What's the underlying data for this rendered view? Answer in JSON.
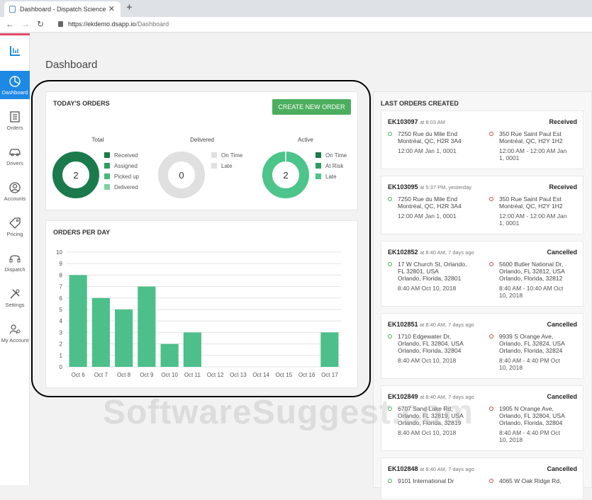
{
  "browser": {
    "tab_title": "Dashboard - Dispatch Science",
    "tab_close": "✕",
    "new_tab": "+",
    "url_host": "https://ekdemo.dsapp.io",
    "url_path": "/Dashboard"
  },
  "sidebar": {
    "items": [
      {
        "label": "Dashboard",
        "icon": "dashboard-icon"
      },
      {
        "label": "Orders",
        "icon": "orders-icon"
      },
      {
        "label": "Drivers",
        "icon": "car-icon"
      },
      {
        "label": "Accounts",
        "icon": "user-icon"
      },
      {
        "label": "Pricing",
        "icon": "tag-icon"
      },
      {
        "label": "Dispatch",
        "icon": "headset-icon"
      },
      {
        "label": "Settings",
        "icon": "tools-icon"
      },
      {
        "label": "My Account",
        "icon": "user-gear-icon"
      }
    ]
  },
  "page": {
    "title": "Dashboard"
  },
  "todays_orders": {
    "title": "TODAY'S ORDERS",
    "create_button": "CREATE NEW ORDER",
    "donuts": [
      {
        "title": "Total",
        "value": "2",
        "legend": [
          "Received",
          "Assigned",
          "Picked up",
          "Delivered"
        ],
        "colors": [
          "#1b7a4b",
          "#2e9d63",
          "#46b878",
          "#7fcf9f"
        ]
      },
      {
        "title": "Delivered",
        "value": "0",
        "legend": [
          "On Time",
          "Late"
        ],
        "colors": [
          "#e0e0e0",
          "#e0e0e0"
        ]
      },
      {
        "title": "Active",
        "value": "2",
        "legend": [
          "On Time",
          "At Risk",
          "Late"
        ],
        "colors": [
          "#1b7a4b",
          "#2e9d63",
          "#4cc48a"
        ]
      }
    ]
  },
  "orders_per_day": {
    "title": "ORDERS PER DAY"
  },
  "chart_data": {
    "type": "bar",
    "title": "ORDERS PER DAY",
    "categories": [
      "Oct 6",
      "Oct 7",
      "Oct 8",
      "Oct 9",
      "Oct 10",
      "Oct 11",
      "Oct 12",
      "Oct 13",
      "Oct 14",
      "Oct 15",
      "Oct 16",
      "Oct 17"
    ],
    "values": [
      8,
      6,
      5,
      7,
      2,
      3,
      0,
      0,
      0,
      0,
      0,
      3
    ],
    "ylim": [
      0,
      10
    ],
    "yticks": [
      "0",
      "1",
      "2",
      "3",
      "4",
      "5",
      "6",
      "7",
      "8",
      "9",
      "10"
    ],
    "color": "#4cbf8a",
    "grid": true
  },
  "last_orders": {
    "title": "LAST ORDERS CREATED",
    "orders": [
      {
        "id": "EK103097",
        "time": "at 8:03 AM",
        "status": "Received",
        "pickup": [
          "7250 Rue du Mile End",
          "Montréal, QC, H2R 3A4"
        ],
        "pickup_time": "12:00 AM Jan 1, 0001",
        "dropoff": [
          "350 Rue Saint Paul Est",
          "Montréal, QC, H2Y 1H2"
        ],
        "dropoff_time": [
          "12:00 AM - 12:00 AM Jan",
          "1, 0001"
        ]
      },
      {
        "id": "EK103095",
        "time": "at 5:37 PM, yesterday",
        "status": "Received",
        "pickup": [
          "7250 Rue du Mile End",
          "Montréal, QC, H2R 3A4"
        ],
        "pickup_time": "12:00 AM Jan 1, 0001",
        "dropoff": [
          "350 Rue Saint Paul Est",
          "Montréal, QC, H2Y 1H2"
        ],
        "dropoff_time": [
          "12:00 AM - 12:00 AM Jan",
          "1, 0001"
        ]
      },
      {
        "id": "EK102852",
        "time": "at 8:40 AM, 7 days ago",
        "status": "Cancelled",
        "pickup": [
          "17 W Church St, Orlando,",
          "FL 32801, USA",
          "Orlando, Florida, 32801"
        ],
        "pickup_time": "8:40 AM Oct 10, 2018",
        "dropoff": [
          "5600 Butler National Dr,",
          "Orlando, FL 32812, USA",
          "Orlando, Florida, 32812"
        ],
        "dropoff_time": [
          "8:40 AM - 10:40 AM Oct",
          "10, 2018"
        ]
      },
      {
        "id": "EK102851",
        "time": "at 8:40 AM, 7 days ago",
        "status": "Cancelled",
        "pickup": [
          "1710 Edgewater Dr,",
          "Orlando, FL 32804, USA",
          "Orlando, Florida, 32804"
        ],
        "pickup_time": "8:40 AM Oct 10, 2018",
        "dropoff": [
          "9939 S Orange Ave,",
          "Orlando, FL 32824, USA",
          "Orlando, Florida, 32824"
        ],
        "dropoff_time": [
          "8:40 AM - 4:40 PM Oct",
          "10, 2018"
        ]
      },
      {
        "id": "EK102849",
        "time": "at 8:40 AM, 7 days ago",
        "status": "Cancelled",
        "pickup": [
          "6707 Sand Lake Rd,",
          "Orlando, FL 32819, USA",
          "Orlando, Florida, 32819"
        ],
        "pickup_time": "8:40 AM Oct 10, 2018",
        "dropoff": [
          "1905 N Orange Ave,",
          "Orlando, FL 32804, USA",
          "Orlando, Florida, 32804"
        ],
        "dropoff_time": [
          "8:40 AM - 4:40 PM Oct",
          "10, 2018"
        ]
      },
      {
        "id": "EK102848",
        "time": "at 8:40 AM, 7 days ago",
        "status": "Cancelled",
        "pickup": [
          "9101 International Dr"
        ],
        "pickup_time": "",
        "dropoff": [
          "4065 W Oak Ridge Rd,"
        ],
        "dropoff_time": []
      }
    ]
  },
  "watermark": "SoftwareSuggest.com"
}
